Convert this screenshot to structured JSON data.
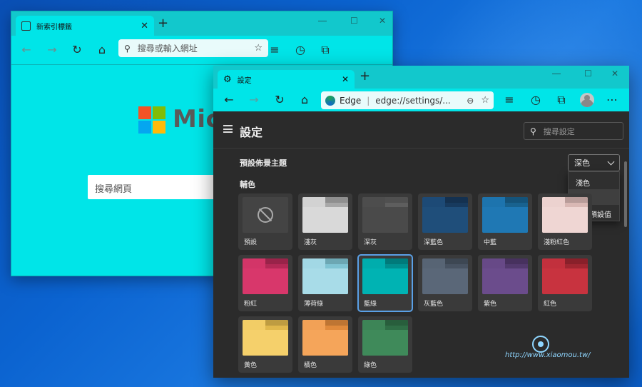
{
  "back_window": {
    "tab_title": "新索引標籤",
    "tab_close": "✕",
    "new_tab": "+",
    "address_placeholder": "搜尋或輸入網址",
    "logo_text": "Micr",
    "search_placeholder": "搜尋網頁"
  },
  "front_window": {
    "tab_title": "設定",
    "tab_close": "✕",
    "new_tab": "+",
    "address_site": "Edge",
    "address_url": "edge://settings/...",
    "page_title": "設定",
    "search_placeholder": "搜尋設定",
    "theme_label": "預設佈景主題",
    "theme_value": "深色",
    "theme_options": [
      "淺色",
      "深色",
      "系統預設值"
    ],
    "accent_label": "輔色",
    "accents": [
      {
        "label": "預設",
        "color": "#444444",
        "dark": "#444444"
      },
      {
        "label": "淺灰",
        "color": "#d9d9d9",
        "dark": "#a8a8a8"
      },
      {
        "label": "深灰",
        "color": "#4a4a4a",
        "dark": "#5e5e5e"
      },
      {
        "label": "深藍色",
        "color": "#1f4e7a",
        "dark": "#173a5e"
      },
      {
        "label": "中藍",
        "color": "#1f78b4",
        "dark": "#18628f"
      },
      {
        "label": "淺粉紅色",
        "color": "#efd6d3",
        "dark": "#d9b8b4"
      },
      {
        "label": "粉紅",
        "color": "#d8376b",
        "dark": "#b42956"
      },
      {
        "label": "薄荷綠",
        "color": "#a8dce8",
        "dark": "#7fc4d3"
      },
      {
        "label": "藍綠",
        "color": "#00b3b3",
        "dark": "#008f8f"
      },
      {
        "label": "灰藍色",
        "color": "#5a6778",
        "dark": "#485362"
      },
      {
        "label": "紫色",
        "color": "#6b4c8c",
        "dark": "#533a6e"
      },
      {
        "label": "紅色",
        "color": "#c8333f",
        "dark": "#a12631"
      },
      {
        "label": "黃色",
        "color": "#f5d06b",
        "dark": "#e0b84c"
      },
      {
        "label": "橘色",
        "color": "#f5a55a",
        "dark": "#e08a3c"
      },
      {
        "label": "綠色",
        "color": "#3f8a5a",
        "dark": "#2f6e46"
      }
    ],
    "selected_accent": "藍綠"
  },
  "watermark": "http://www.xiaomou.tw/"
}
